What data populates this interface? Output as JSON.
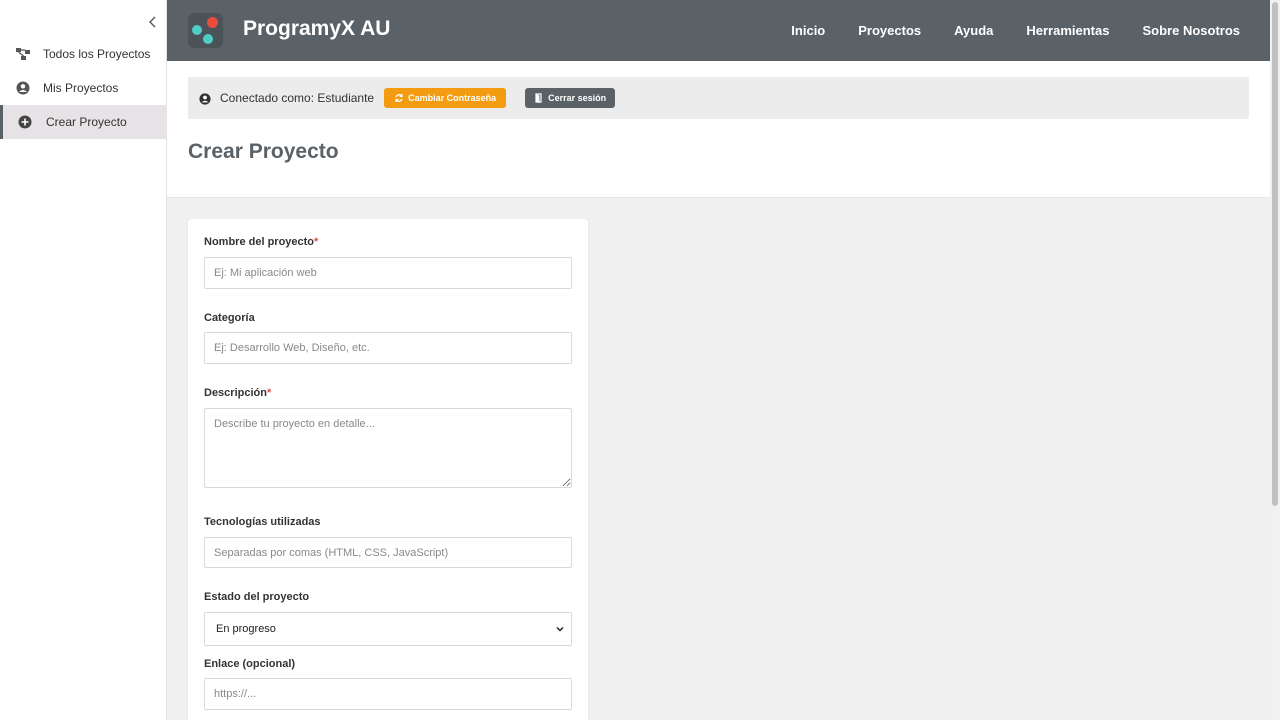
{
  "sidebar": {
    "items": [
      {
        "label": "Todos los Proyectos",
        "icon": "project-diagram-icon"
      },
      {
        "label": "Mis Proyectos",
        "icon": "user-circle-icon"
      },
      {
        "label": "Crear Proyecto",
        "icon": "plus-circle-icon",
        "active": true
      }
    ]
  },
  "header": {
    "brand": "ProgramyX AU",
    "nav": [
      "Inicio",
      "Proyectos",
      "Ayuda",
      "Herramientas",
      "Sobre Nosotros"
    ]
  },
  "userbar": {
    "connected_text": "Conectado como: Estudiante",
    "change_password": "Cambiar Contraseña",
    "logout": "Cerrar sesión"
  },
  "page": {
    "title": "Crear Proyecto"
  },
  "form": {
    "name_label": "Nombre del proyecto",
    "name_placeholder": "Ej: Mi aplicación web",
    "category_label": "Categoría",
    "category_placeholder": "Ej: Desarrollo Web, Diseño, etc.",
    "description_label": "Descripción",
    "description_placeholder": "Describe tu proyecto en detalle...",
    "tech_label": "Tecnologías utilizadas",
    "tech_placeholder": "Separadas por comas (HTML, CSS, JavaScript)",
    "status_label": "Estado del proyecto",
    "status_value": "En progreso",
    "link_label": "Enlace (opcional)",
    "link_placeholder": "https://...",
    "required_mark": "*"
  },
  "colors": {
    "header_bg": "#5a6268",
    "accent_orange": "#f39c12",
    "required_red": "#e74c3c",
    "logo_red": "#e74c3c",
    "logo_teal": "#4ecdc4"
  }
}
